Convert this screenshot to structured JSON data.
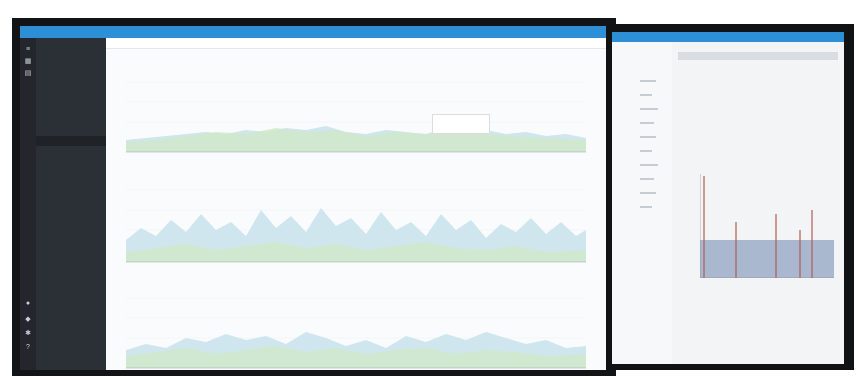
{
  "main_screen": {
    "sidebar": {
      "title": "",
      "items": [
        {
          "label": ""
        },
        {
          "label": ""
        },
        {
          "label": ""
        },
        {
          "label": ""
        },
        {
          "label": ""
        },
        {
          "label": ""
        }
      ]
    },
    "tabs": [
      ""
    ],
    "charts": [
      {
        "title": ""
      },
      {
        "title": ""
      },
      {
        "title": ""
      }
    ]
  },
  "second_screen": {
    "header": "",
    "heading_line1": "",
    "heading_line2": ""
  },
  "colors": {
    "topbar": "#2d8fd6",
    "sidebar": "#2b2f36",
    "chart_fill_green": "#cfe8c8",
    "chart_fill_blue": "#cfe6ef",
    "bar_fill": "#a9b7cf",
    "bar_spike": "#b15b55"
  }
}
